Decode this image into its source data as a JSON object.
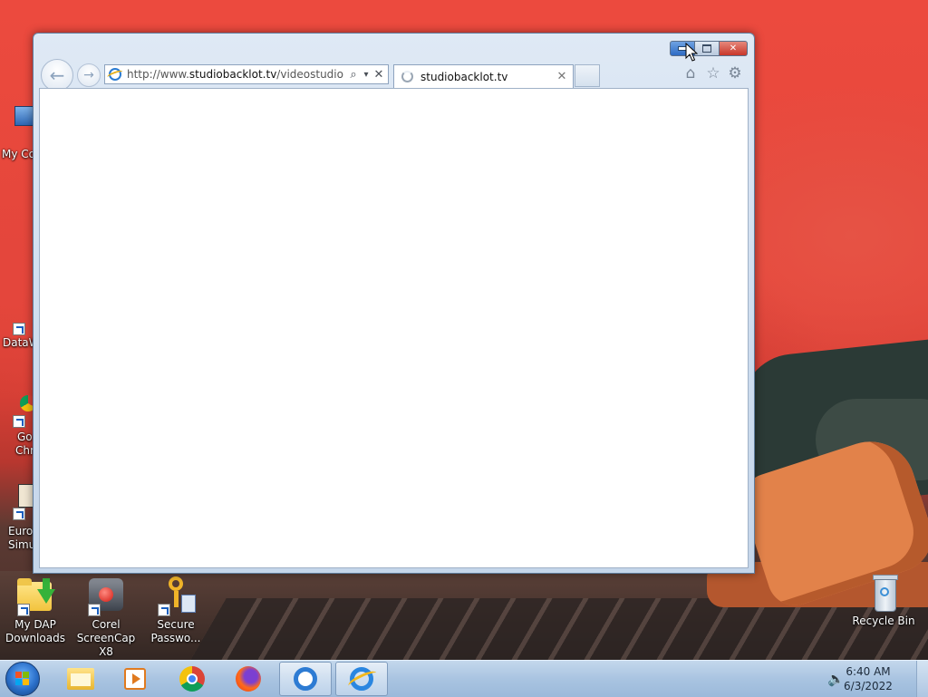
{
  "desktop": {
    "icons": [
      {
        "name": "my-dap-downloads",
        "label_line1": "My DAP",
        "label_line2": "Downloads"
      },
      {
        "name": "corel-screencap",
        "label_line1": "Corel",
        "label_line2": "ScreenCap X8"
      },
      {
        "name": "secure-password",
        "label_line1": "Secure",
        "label_line2": "Passwo..."
      },
      {
        "name": "recycle-bin",
        "label_line1": "Recycle Bin",
        "label_line2": ""
      }
    ],
    "edge_labels": {
      "my_computer": "My Co",
      "datawatch": "DataW",
      "google_chrome_1": "Go",
      "google_chrome_2": "Chr",
      "euro_sim_1": "Euro",
      "euro_sim_2": "Simu"
    }
  },
  "browser": {
    "url_prefix": "http://www.",
    "url_host": "studiobacklot.tv",
    "url_path": "/videostudio",
    "tab_title": "studiobacklot.tv",
    "search_glyph": "⌕",
    "dropdown_glyph": "▾",
    "stop_glyph": "✕",
    "tab_close_glyph": "✕",
    "back_glyph": "←",
    "forward_glyph": "→",
    "home_glyph": "⌂",
    "favorites_glyph": "☆",
    "tools_glyph": "⚙"
  },
  "taskbar": {
    "time": "6:40 AM",
    "date": "6/3/2022",
    "speaker_glyph": "🔈",
    "pinned": [
      "windows-explorer",
      "media-player",
      "google-chrome",
      "firefox",
      "quicktime",
      "internet-explorer"
    ]
  },
  "colors": {
    "wallpaper_red": "#e4463b",
    "window_frame": "#cddcee",
    "close_red": "#c8372a",
    "taskbar_blue": "#a9c4e1"
  }
}
